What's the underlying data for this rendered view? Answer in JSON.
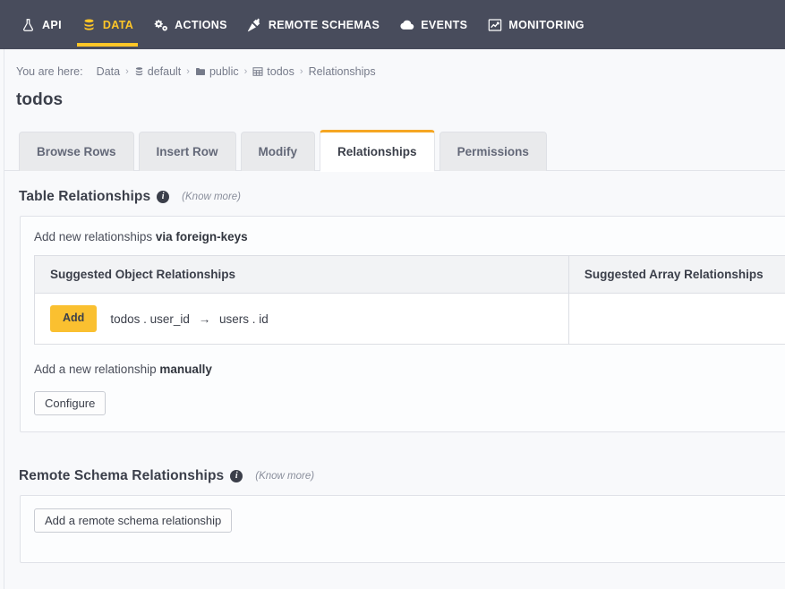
{
  "nav": {
    "items": [
      {
        "label": "API",
        "icon": "flask-icon",
        "active": false
      },
      {
        "label": "DATA",
        "icon": "database-icon",
        "active": true
      },
      {
        "label": "ACTIONS",
        "icon": "gears-icon",
        "active": false
      },
      {
        "label": "REMOTE SCHEMAS",
        "icon": "plug-icon",
        "active": false
      },
      {
        "label": "EVENTS",
        "icon": "cloud-icon",
        "active": false
      },
      {
        "label": "MONITORING",
        "icon": "chart-line-icon",
        "active": false
      }
    ]
  },
  "breadcrumb": {
    "prefix": "You are here:",
    "items": [
      {
        "label": "Data",
        "icon": null
      },
      {
        "label": "default",
        "icon": "database-icon"
      },
      {
        "label": "public",
        "icon": "folder-icon"
      },
      {
        "label": "todos",
        "icon": "table-icon"
      },
      {
        "label": "Relationships",
        "icon": null
      }
    ],
    "separator": "›"
  },
  "page": {
    "title": "todos"
  },
  "tabs": [
    {
      "label": "Browse Rows",
      "active": false
    },
    {
      "label": "Insert Row",
      "active": false
    },
    {
      "label": "Modify",
      "active": false
    },
    {
      "label": "Relationships",
      "active": true
    },
    {
      "label": "Permissions",
      "active": false
    }
  ],
  "table_relationships": {
    "heading": "Table Relationships",
    "know_more": "(Know more)",
    "fk_text_plain": "Add new relationships ",
    "fk_text_bold": "via foreign-keys",
    "columns": {
      "object": "Suggested Object Relationships",
      "array": "Suggested Array Relationships"
    },
    "suggestions": [
      {
        "add_label": "Add",
        "source_table": "todos",
        "source_column": "user_id",
        "arrow": "→",
        "target_table": "users",
        "target_column": "id"
      }
    ],
    "manual_text_plain": "Add a new relationship ",
    "manual_text_bold": "manually",
    "configure_label": "Configure"
  },
  "remote_schema_relationships": {
    "heading": "Remote Schema Relationships",
    "know_more": "(Know more)",
    "add_label": "Add a remote schema relationship"
  },
  "colors": {
    "nav_bg": "#484c5c",
    "accent": "#ffc627",
    "tab_accent": "#f5a623",
    "add_button": "#fac030",
    "page_bg": "#f8f9fb",
    "text_dark": "#3b3f4a"
  }
}
